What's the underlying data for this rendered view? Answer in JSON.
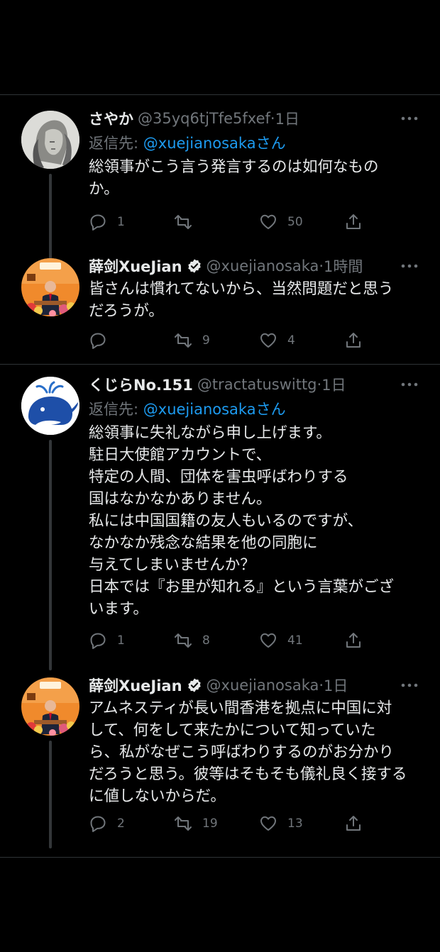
{
  "tweets": [
    {
      "name": "さやか",
      "handle": "@35yq6tjTfe5fxef",
      "time": "1日",
      "verified": false,
      "reply_prefix": "返信先: ",
      "reply_mention": "@xuejianosakaさん",
      "text": "総領事がこう言う発言するのは如何なもの\nか。",
      "replies": "1",
      "retweets": "",
      "likes": "50"
    },
    {
      "name": "薛剑XueJian",
      "handle": "@xuejianosaka",
      "time": "1時間",
      "verified": true,
      "text": "皆さんは慣れてないから、当然問題だと思う\nだろうが。",
      "replies": "",
      "retweets": "9",
      "likes": "4"
    },
    {
      "name": "くじらNo.151",
      "handle": "@tractatuswittg",
      "time": "1日",
      "verified": false,
      "reply_prefix": "返信先: ",
      "reply_mention": "@xuejianosakaさん",
      "text": "総領事に失礼ながら申し上げます。\n駐日大使館アカウントで、\n特定の人間、団体を害虫呼ばわりする\n国はなかなかありません。\n私には中国国籍の友人もいるのですが、\nなかなか残念な結果を他の同胞に\n与えてしまいませんか？\n日本では『お里が知れる』という言葉がござ\nいます。",
      "replies": "1",
      "retweets": "8",
      "likes": "41"
    },
    {
      "name": "薛剑XueJian",
      "handle": "@xuejianosaka",
      "time": "1日",
      "verified": true,
      "text": "アムネスティが長い間香港を拠点に中国に対\nして、何をして来たかについて知っていた\nら、私がなぜこう呼ばわりするのがお分かり\nだろうと思う。彼等はそもそも儀礼良く接する\nに値しないからだ。",
      "replies": "2",
      "retweets": "19",
      "likes": "13"
    }
  ],
  "separator": "·",
  "colors": {
    "accent": "#1d9bf0",
    "muted": "#71767b",
    "text": "#e7e9ea",
    "bg": "#000000"
  }
}
